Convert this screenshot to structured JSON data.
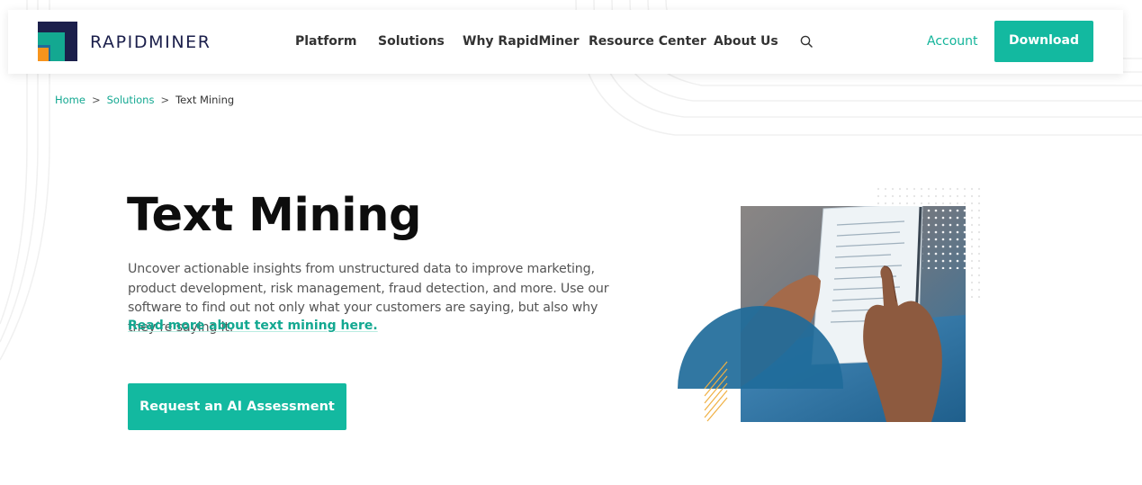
{
  "brand": {
    "name": "RAPIDMINER",
    "logo_colors": {
      "navy": "#1b1f4b",
      "teal": "#13a891",
      "blue": "#1f6b9a",
      "orange": "#f7941d"
    }
  },
  "nav": {
    "items": [
      {
        "label": "Platform"
      },
      {
        "label": "Solutions"
      },
      {
        "label": "Why RapidMiner"
      },
      {
        "label": "Resource Center"
      },
      {
        "label": "About Us"
      }
    ],
    "search_icon": "search-icon",
    "account_label": "Account",
    "download_label": "Download"
  },
  "breadcrumb": {
    "items": [
      "Home",
      "Solutions",
      "Text Mining"
    ],
    "separator": ">"
  },
  "hero": {
    "title": "Text Mining",
    "description": "Uncover actionable insights from unstructured data to improve marketing, product development, risk management, fraud detection, and more. Use our software to find out not only what your customers are saying, but also why they’re saying it.",
    "link_label": "Read more about text mining here.",
    "cta_label": "Request an AI Assessment"
  },
  "colors": {
    "accent": "#13b9a0",
    "link": "#13a891",
    "arc_blue": "#1f6b9a",
    "stripe_orange": "#f0b042"
  }
}
